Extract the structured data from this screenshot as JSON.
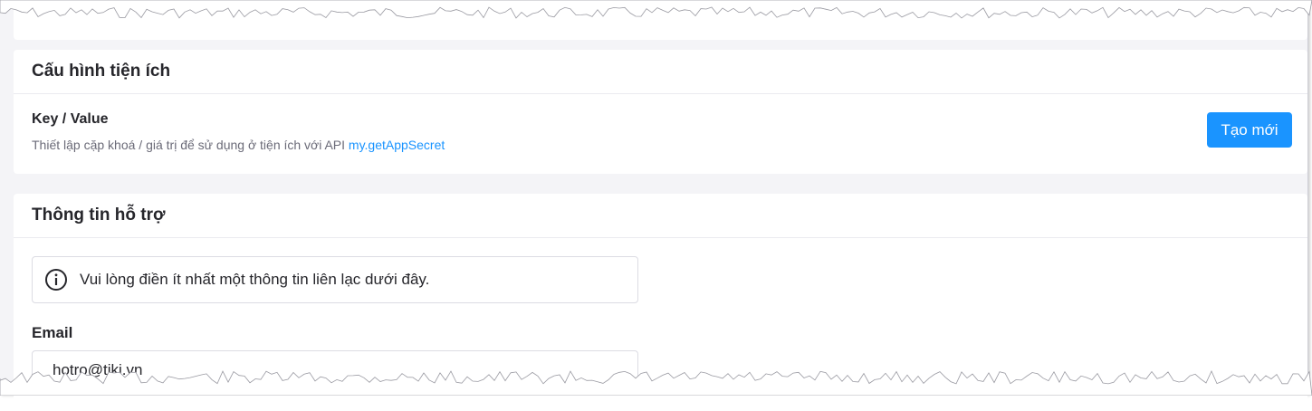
{
  "config_section": {
    "title": "Cấu hình tiện ích",
    "key_value": {
      "title": "Key / Value",
      "description": "Thiết lập cặp khoá / giá trị để sử dụng ở tiện ích với API",
      "api_link": "my.getAppSecret",
      "create_button": "Tạo mới"
    }
  },
  "support_section": {
    "title": "Thông tin hỗ trợ",
    "notice": {
      "icon": "info-circle-icon",
      "text": "Vui lòng điền ít nhất một thông tin liên lạc dưới đây."
    },
    "email": {
      "label": "Email",
      "value": "hotro@tiki.vn"
    }
  },
  "colors": {
    "accent": "#1a94ff",
    "page_background": "#f4f4f7",
    "card_background": "#ffffff"
  }
}
